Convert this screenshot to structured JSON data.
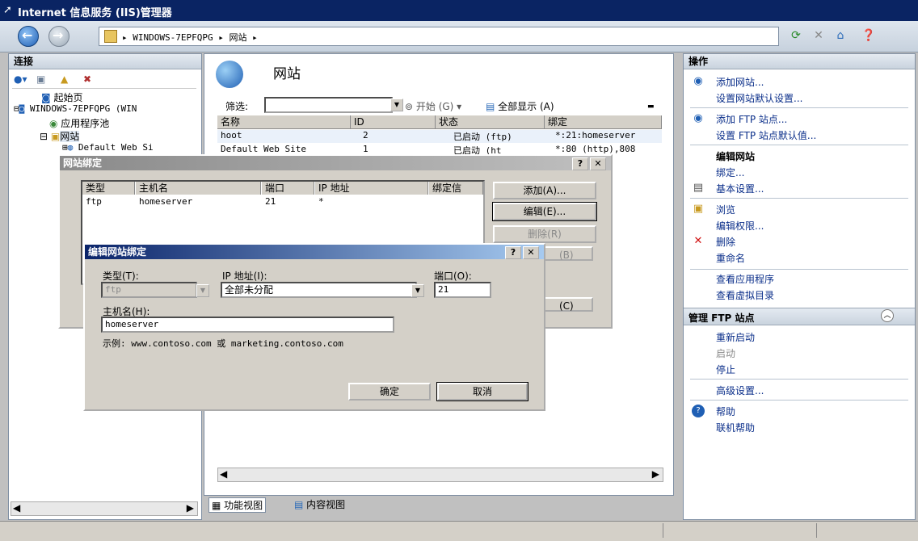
{
  "window": {
    "title": "Internet 信息服务 (IIS)管理器"
  },
  "address": {
    "server": "WINDOWS-7EPFQPG",
    "node": "网站"
  },
  "left": {
    "header": "连接",
    "tree": {
      "start": "起始页",
      "server": "WINDOWS-7EPFQPG (WIN",
      "apppools": "应用程序池",
      "sites": "网站",
      "site1": "Default Web Si"
    }
  },
  "center": {
    "title": "网站",
    "filter_label": "筛选:",
    "start_label": "开始 (G)",
    "showall_label": "全部显示 (A)",
    "columns": [
      "名称",
      "ID",
      "状态",
      "绑定"
    ],
    "rows": [
      {
        "name": "hoot",
        "id": "2",
        "status": "已启动 (ftp)",
        "binding": "*:21:homeserver"
      },
      {
        "name": "Default Web Site",
        "id": "1",
        "status": "已启动 (ht",
        "binding": "*:80 (http),808"
      }
    ],
    "tab_features": "功能视图",
    "tab_content": "内容视图"
  },
  "right": {
    "header": "操作",
    "add_site": "添加网站...",
    "site_defaults": "设置网站默认设置...",
    "add_ftp": "添加 FTP 站点...",
    "ftp_defaults": "设置 FTP 站点默认值...",
    "edit_site": "编辑网站",
    "bindings": "绑定...",
    "basic": "基本设置...",
    "browse": "浏览",
    "edit_perm": "编辑权限...",
    "delete": "删除",
    "rename": "重命名",
    "view_apps": "查看应用程序",
    "view_vdirs": "查看虚拟目录",
    "manage_ftp": "管理 FTP 站点",
    "restart": "重新启动",
    "start": "启动",
    "stop": "停止",
    "advanced": "高级设置...",
    "help": "帮助",
    "online_help": "联机帮助"
  },
  "bindings_dialog": {
    "title": "网站绑定",
    "columns": [
      "类型",
      "主机名",
      "端口",
      "IP 地址",
      "绑定信"
    ],
    "row": {
      "type": "ftp",
      "host": "homeserver",
      "port": "21",
      "ip": "*"
    },
    "add": "添加(A)...",
    "edit": "编辑(E)...",
    "remove": "删除(R)",
    "browse_partial": "(B)",
    "close_partial": "(C)"
  },
  "edit_dialog": {
    "title": "编辑网站绑定",
    "type_label": "类型(T):",
    "type_value": "ftp",
    "ip_label": "IP 地址(I):",
    "ip_value": "全部未分配",
    "port_label": "端口(O):",
    "port_value": "21",
    "host_label": "主机名(H):",
    "host_value": "homeserver",
    "example": "示例: www.contoso.com 或 marketing.contoso.com",
    "ok": "确定",
    "cancel": "取消"
  }
}
